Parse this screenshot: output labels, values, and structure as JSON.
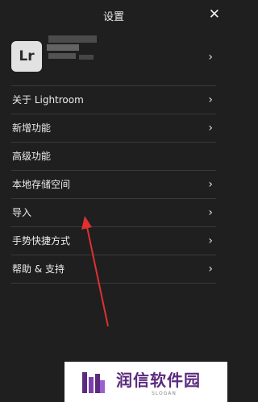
{
  "header": {
    "title": "设置",
    "close_symbol": "✕"
  },
  "account": {
    "logo_text": "Lr"
  },
  "menu": [
    {
      "label": "关于 Lightroom",
      "has_chevron": true
    },
    {
      "label": "新增功能",
      "has_chevron": true
    },
    {
      "label": "高级功能",
      "has_chevron": false
    },
    {
      "label": "本地存储空间",
      "has_chevron": true
    },
    {
      "label": "导入",
      "has_chevron": true
    },
    {
      "label": "手势快捷方式",
      "has_chevron": true
    },
    {
      "label": "帮助 & 支持",
      "has_chevron": true
    }
  ],
  "chevron_symbol": "›",
  "watermark": {
    "name": "润信软件园",
    "slogan": "SLOGAN"
  },
  "colors": {
    "background": "#1f1f1f",
    "annotation_arrow": "#e03030",
    "watermark_text": "#5b2b7e"
  }
}
